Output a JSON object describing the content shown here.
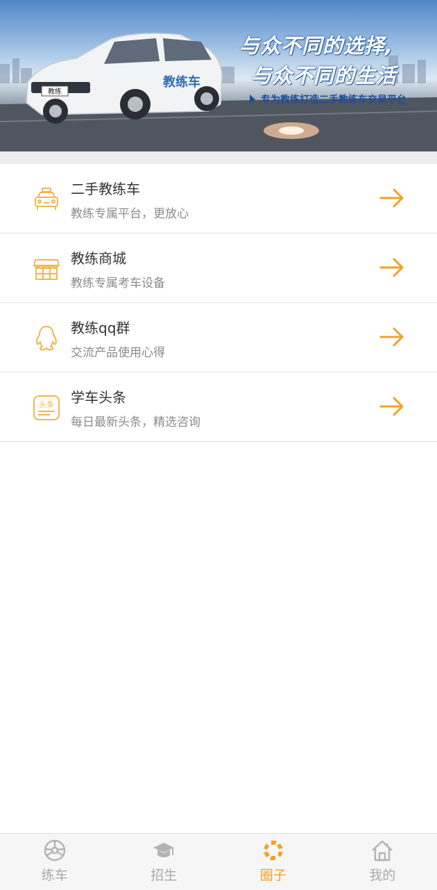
{
  "banner": {
    "slogan_line1": "与众不同的选择,",
    "slogan_line2": "与众不同的生活",
    "subtitle": "专为教练打造二手教练车交易平台",
    "car_door_text": "教练车",
    "car_plate_text": "教练"
  },
  "menu": {
    "items": [
      {
        "title": "二手教练车",
        "subtitle": "教练专属平台，更放心",
        "icon": "car-icon"
      },
      {
        "title": "教练商城",
        "subtitle": "教练专属考车设备",
        "icon": "store-icon"
      },
      {
        "title": "教练qq群",
        "subtitle": "交流产品使用心得",
        "icon": "qq-icon"
      },
      {
        "title": "学车头条",
        "subtitle": "每日最新头条，精选咨询",
        "icon": "news-icon",
        "icon_text": "头条"
      }
    ]
  },
  "tabbar": {
    "items": [
      {
        "label": "练车",
        "icon": "steering-wheel-icon",
        "active": false
      },
      {
        "label": "招生",
        "icon": "graduation-cap-icon",
        "active": false
      },
      {
        "label": "圈子",
        "icon": "circle-community-icon",
        "active": true
      },
      {
        "label": "我的",
        "icon": "home-icon",
        "active": false
      }
    ]
  },
  "colors": {
    "accent": "#f0a224",
    "icon_orange": "#f2b64c",
    "text_primary": "#333333",
    "text_secondary": "#8a8a8a",
    "tab_inactive": "#a9a9a9"
  }
}
